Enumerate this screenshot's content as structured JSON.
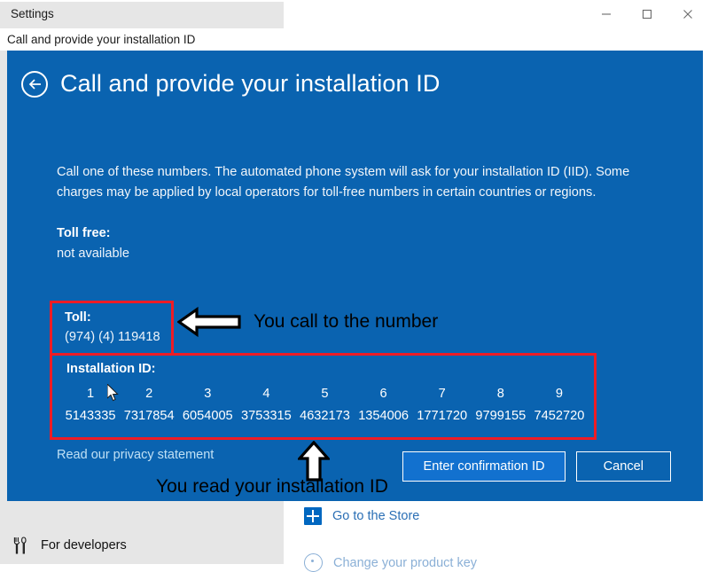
{
  "window": {
    "title": "Settings",
    "breadcrumb": "Call and provide your installation ID",
    "controls": {
      "minimize": "minimize-icon",
      "maximize": "maximize-icon",
      "close": "close-icon"
    }
  },
  "dialog": {
    "back_icon": "back-arrow-icon",
    "title": "Call and provide your installation ID",
    "intro": "Call one of these numbers. The automated phone system will ask for your installation ID (IID). Some charges may be applied by local operators for toll-free numbers in certain countries or regions.",
    "toll_free": {
      "label": "Toll free:",
      "value": "not available"
    },
    "toll": {
      "label": "Toll:",
      "value": "(974) (4) 119418"
    },
    "installation": {
      "label": "Installation ID:",
      "indexes": [
        "1",
        "2",
        "3",
        "4",
        "5",
        "6",
        "7",
        "8",
        "9"
      ],
      "blocks": [
        "5143335",
        "7317854",
        "6054005",
        "3753315",
        "4632173",
        "1354006",
        "1771720",
        "9799155",
        "7452720"
      ]
    },
    "privacy_link": "Read our privacy statement",
    "buttons": {
      "confirm": "Enter confirmation ID",
      "cancel": "Cancel"
    }
  },
  "annotations": {
    "call_caption": "You call to the number",
    "read_caption": "You read your installation ID",
    "left_arrow_icon": "left-arrow-annotation-icon",
    "up_arrow_icon": "up-arrow-annotation-icon",
    "highlight_color": "#ee1c25"
  },
  "background": {
    "sidebar_item": {
      "label": "For developers",
      "icon": "developer-tools-icon"
    },
    "store_link": "Go to the Store",
    "store_icon": "store-icon",
    "partial_row_text": "Change your product key",
    "partial_row_icon": "info-circle-icon"
  },
  "colors": {
    "dialog_background": "#0a63b0",
    "accent": "#1271cf",
    "link": "#bfe0f5",
    "highlight": "#ee1c25"
  }
}
